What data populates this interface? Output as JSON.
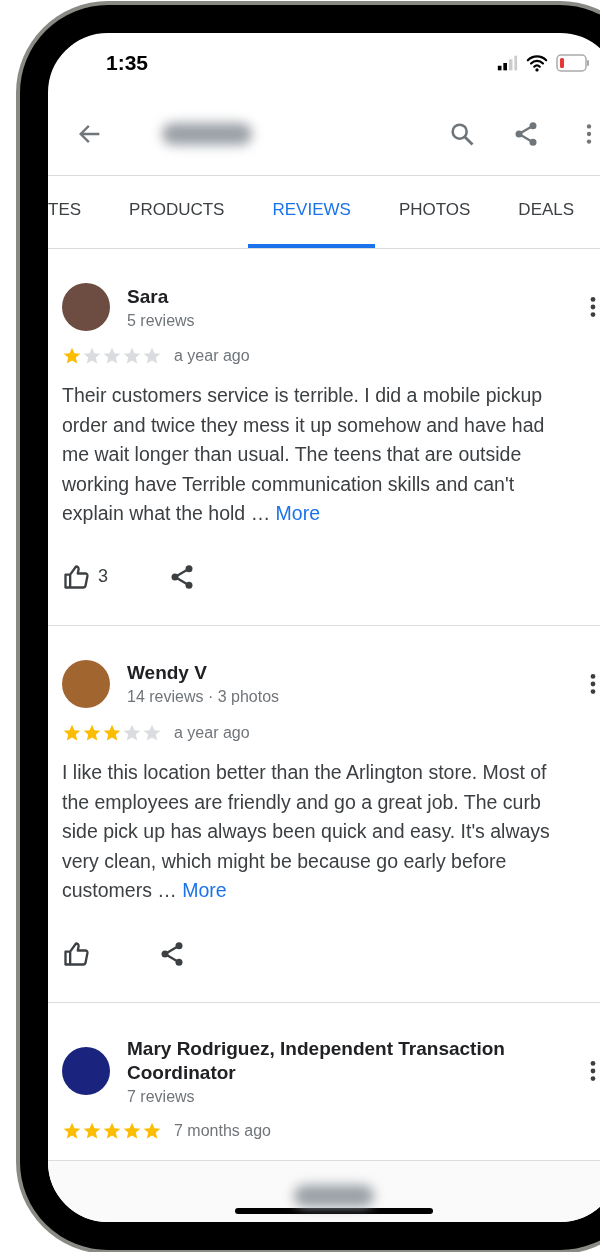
{
  "status_bar": {
    "time": "1:35"
  },
  "tabs": [
    {
      "label": "TES",
      "selected": false
    },
    {
      "label": "PRODUCTS",
      "selected": false
    },
    {
      "label": "REVIEWS",
      "selected": true
    },
    {
      "label": "PHOTOS",
      "selected": false
    },
    {
      "label": "DEALS",
      "selected": false
    }
  ],
  "reviews": [
    {
      "name": "Sara",
      "meta": "5 reviews",
      "stars": 1,
      "time": "a year ago",
      "text": "Their customers service is terrible. I did a mobile pickup order and twice they mess it up somehow and have had me wait longer than usual. The teens that are outside working have Terrible communication skills and can't explain what the hold …",
      "more": "More",
      "likes": "3"
    },
    {
      "name": "Wendy V",
      "meta": "14 reviews · 3 photos",
      "stars": 3,
      "time": "a year ago",
      "text": "I like this location better than the Arlington store. Most of the employees are friendly and go a great job. The curb side pick up has always been quick and easy. It's always very clean, which might be because go early before customers …",
      "more": "More"
    },
    {
      "name": "Mary Rodriguez, Independent Transaction Coordinator",
      "meta": "7 reviews",
      "stars": 5,
      "time": "7 months ago"
    }
  ]
}
